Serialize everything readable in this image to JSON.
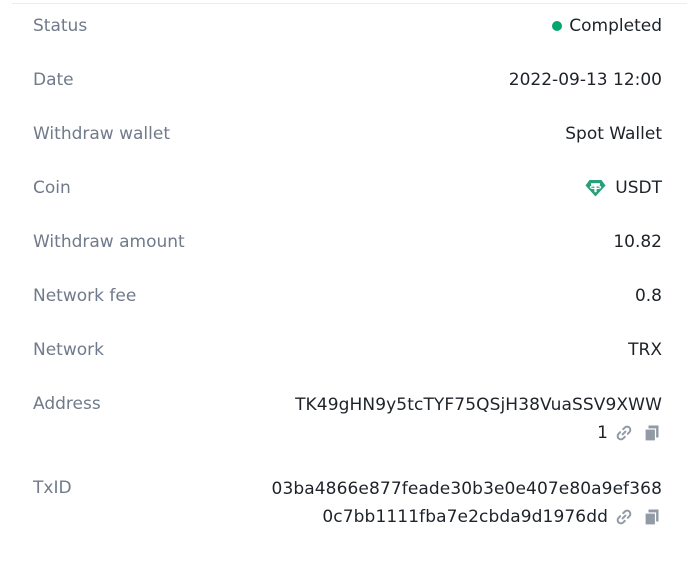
{
  "details": {
    "status": {
      "label": "Status",
      "value": "Completed",
      "color": "#03a66d"
    },
    "date": {
      "label": "Date",
      "value": "2022-09-13 12:00"
    },
    "wallet": {
      "label": "Withdraw wallet",
      "value": "Spot Wallet"
    },
    "coin": {
      "label": "Coin",
      "value": "USDT",
      "icon": "tether-icon",
      "icon_color": "#26a17b"
    },
    "amount": {
      "label": "Withdraw amount",
      "value": "10.82"
    },
    "fee": {
      "label": "Network fee",
      "value": "0.8"
    },
    "network": {
      "label": "Network",
      "value": "TRX"
    },
    "address": {
      "label": "Address",
      "line1": "TK49gHN9y5tcTYF75QSjH38VuaSSV9XWW",
      "line2": "1"
    },
    "txid": {
      "label": "TxID",
      "line1": "03ba4866e877feade30b3e0e407e80a9ef368",
      "line2": "0c7bb1111fba7e2cbda9d1976dd"
    }
  }
}
